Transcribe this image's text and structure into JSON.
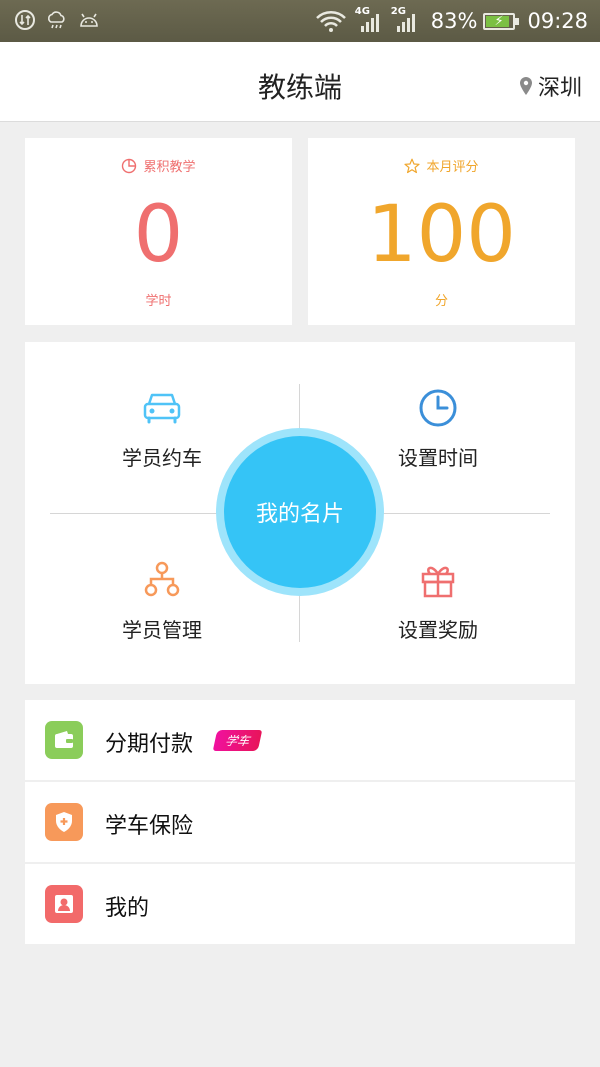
{
  "status_bar": {
    "net_4g": "4G",
    "net_2g": "2G",
    "battery": "83%",
    "time": "09:28"
  },
  "header": {
    "title": "教练端",
    "location": "深圳"
  },
  "stats": {
    "teaching": {
      "label": "累积教学",
      "value": "0",
      "unit": "学时",
      "color": "#ef6f6f"
    },
    "rating": {
      "label": "本月评分",
      "value": "100",
      "unit": "分",
      "color": "#f0a62c"
    }
  },
  "features": {
    "student_booking": "学员约车",
    "set_time": "设置时间",
    "my_card": "我的名片",
    "student_management": "学员管理",
    "set_reward": "设置奖励"
  },
  "list": {
    "installment": {
      "label": "分期付款",
      "tag": "学车",
      "icon": "wallet-icon",
      "color": "#8bcd5a"
    },
    "insurance": {
      "label": "学车保险",
      "icon": "shield-icon",
      "color": "#f7995a"
    },
    "mine": {
      "label": "我的",
      "icon": "person-icon",
      "color": "#f26a6a"
    }
  }
}
